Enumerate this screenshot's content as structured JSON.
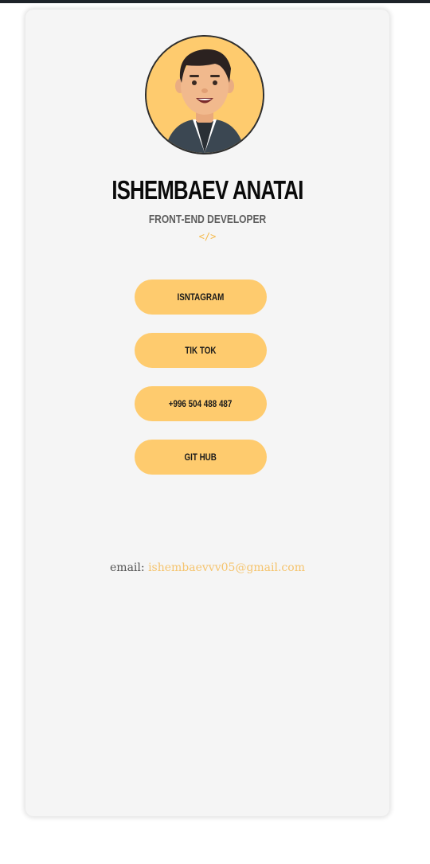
{
  "profile": {
    "name": "ISHEMBAEV ANATAI",
    "role": "FRONT-END DEVELOPER",
    "role_icon": "</>"
  },
  "links": [
    {
      "label": "ISNTAGRAM"
    },
    {
      "label": "TIK TOK"
    },
    {
      "label": "+996 504 488 487"
    },
    {
      "label": "GIT HUB"
    }
  ],
  "contact": {
    "email_label": "email:",
    "email_value": "ishembaevvv05@gmail.com"
  },
  "colors": {
    "accent": "#fecb6e",
    "card_bg": "#f5f5f5",
    "link_text": "#f5c46e"
  }
}
